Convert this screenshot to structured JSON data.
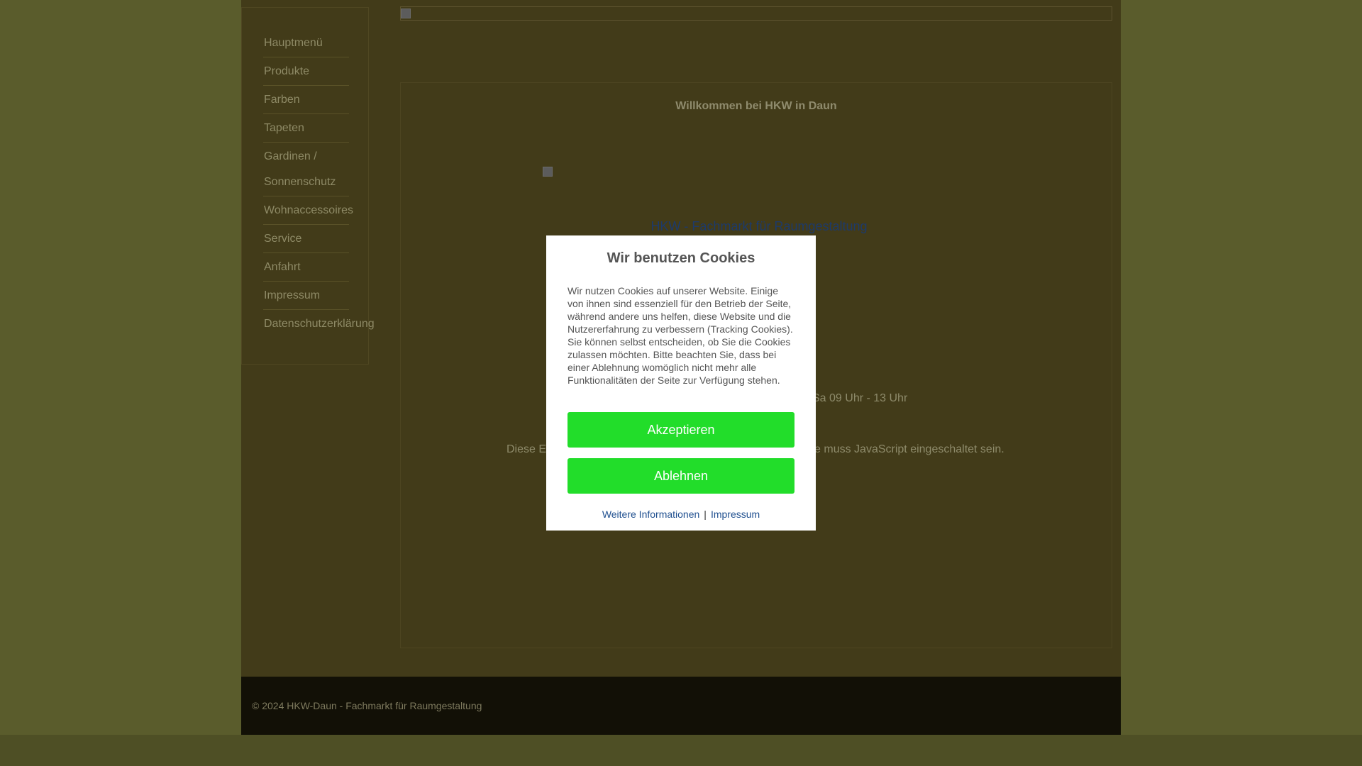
{
  "sidebar": {
    "items": [
      {
        "label": "Hauptmenü"
      },
      {
        "label": "Produkte"
      },
      {
        "label": "Farben"
      },
      {
        "label": "Tapeten"
      },
      {
        "label_line1": "Gardinen /",
        "label_line2": "Sonnenschutz"
      },
      {
        "label": "Wohnaccessoires"
      },
      {
        "label": "Service"
      },
      {
        "label": "Anfahrt"
      },
      {
        "label": "Impressum"
      },
      {
        "label": "Datenschutzerklärung"
      }
    ]
  },
  "main": {
    "welcome": "Willkommen bei HKW in Daun",
    "subtitle": "HKW - Fachmarkt für Raumgestaltung",
    "hours_fragment": "Sa 09 Uhr - 13 Uhr",
    "js_note_start": "Diese E",
    "js_note_end": "e muss JavaScript eingeschaltet sein."
  },
  "footer": {
    "copyright": "© 2024 HKW-Daun - Fachmarkt für Raumgestaltung"
  },
  "cookie": {
    "title": "Wir benutzen Cookies",
    "text": "Wir nutzen Cookies auf unserer Website. Einige von ihnen sind essenziell für den Betrieb der Seite, während andere uns helfen, diese Website und die Nutzererfahrung zu verbessern (Tracking Cookies). Sie können selbst entscheiden, ob Sie die Cookies zulassen möchten. Bitte beachten Sie, dass bei einer Ablehnung womöglich nicht mehr alle Funktionalitäten der Seite zur Verfügung stehen.",
    "accept_label": "Akzeptieren",
    "decline_label": "Ablehnen",
    "more_info_label": "Weitere Informationen",
    "separator": "|",
    "imprint_label": "Impressum"
  },
  "colors": {
    "accept_button": "#22dd2a",
    "link": "#1f4f8f"
  }
}
